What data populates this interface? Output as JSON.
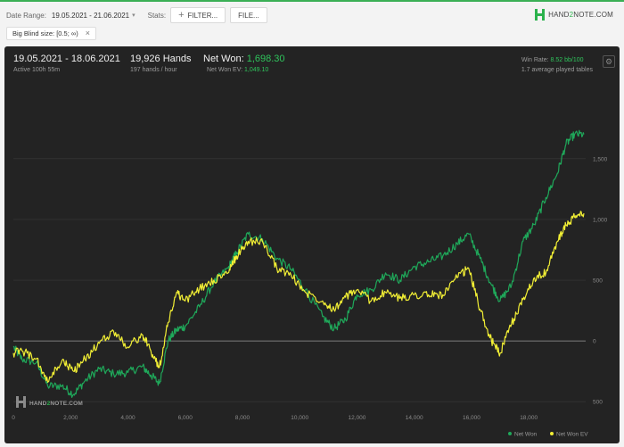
{
  "toolbar": {
    "date_range_label": "Date Range:",
    "date_range_value": "19.05.2021 - 21.06.2021",
    "stats_label": "Stats:",
    "filter_button": "FILTER...",
    "file_button": "FILE..."
  },
  "logo": {
    "pre": "HAND",
    "two": "2",
    "post": "NOTE.COM"
  },
  "filter_chip": {
    "label": "Big Blind size: [0.5; ∞)"
  },
  "summary": {
    "period": "19.05.2021 - 18.06.2021",
    "active": "Active 100h 55m",
    "hands": "19,926 Hands",
    "rate": "197 hands / hour",
    "net_won_label": "Net Won:",
    "net_won_value": "1,698.30",
    "ev_label": "Net Won  EV:",
    "ev_value": "1,049.10",
    "win_rate_label": "Win Rate:",
    "win_rate_value": "8.52 bb/100",
    "tables": "1.7 average played tables"
  },
  "watermark": {
    "pre": "HAND",
    "two": "2",
    "post": "NOTE.COM"
  },
  "colors": {
    "net_won": "#1fa85a",
    "net_won_ev": "#f2ef35",
    "brand": "#2bb24c"
  },
  "chart_data": {
    "type": "line",
    "x_ticks": [
      0,
      2000,
      4000,
      6000,
      8000,
      10000,
      12000,
      14000,
      16000,
      18000
    ],
    "x_tick_labels": [
      "0",
      "2,000",
      "4,000",
      "6,000",
      "8,000",
      "10,000",
      "12,000",
      "14,000",
      "16,000",
      "18,000"
    ],
    "y_ticks": [
      1500,
      1000,
      500,
      0,
      -500
    ],
    "y_tick_labels": [
      "1,500",
      "1,000",
      "500",
      "0",
      "500"
    ],
    "xlim": [
      0,
      19926
    ],
    "ylim": [
      -550,
      1800
    ],
    "grid": true,
    "legend_position": "bottom-right",
    "series": [
      {
        "name": "Net Won",
        "x": [
          0,
          300,
          800,
          1200,
          1700,
          2100,
          2500,
          3000,
          3500,
          4000,
          4500,
          4800,
          5100,
          5400,
          5700,
          6000,
          6500,
          7000,
          7500,
          7800,
          8200,
          8700,
          9200,
          9700,
          10200,
          10800,
          11200,
          11600,
          12000,
          12500,
          13000,
          13500,
          14000,
          14500,
          15000,
          15500,
          15900,
          16300,
          16700,
          17000,
          17400,
          17800,
          18200,
          18600,
          19000,
          19300,
          19600,
          19926
        ],
        "y": [
          -50,
          -150,
          -180,
          -370,
          -370,
          -440,
          -330,
          -230,
          -270,
          -260,
          -210,
          -280,
          -350,
          0,
          90,
          120,
          280,
          480,
          600,
          730,
          880,
          840,
          680,
          590,
          420,
          200,
          100,
          180,
          380,
          420,
          560,
          500,
          610,
          650,
          700,
          800,
          880,
          680,
          460,
          330,
          460,
          820,
          960,
          1180,
          1380,
          1620,
          1700,
          1700
        ]
      },
      {
        "name": "Net Won  EV",
        "x": [
          0,
          300,
          800,
          1200,
          1700,
          2100,
          2500,
          3000,
          3500,
          4000,
          4500,
          4800,
          5100,
          5400,
          5700,
          6000,
          6500,
          7000,
          7500,
          7800,
          8200,
          8700,
          9200,
          9700,
          10200,
          10800,
          11200,
          11600,
          12000,
          12500,
          13000,
          13500,
          14000,
          14500,
          15000,
          15500,
          15900,
          16300,
          16700,
          17000,
          17400,
          17800,
          18200,
          18600,
          19000,
          19300,
          19600,
          19926
        ],
        "y": [
          -100,
          -80,
          -150,
          -340,
          -160,
          -250,
          -150,
          -20,
          80,
          -50,
          50,
          -80,
          -220,
          150,
          400,
          330,
          430,
          500,
          560,
          700,
          820,
          820,
          600,
          540,
          400,
          330,
          260,
          360,
          420,
          330,
          400,
          350,
          380,
          380,
          380,
          520,
          600,
          260,
          0,
          -100,
          140,
          340,
          520,
          560,
          820,
          950,
          1020,
          1050
        ]
      }
    ]
  }
}
